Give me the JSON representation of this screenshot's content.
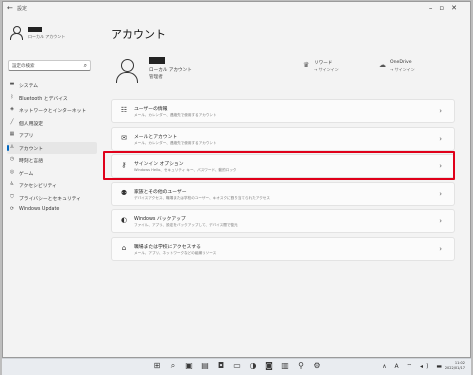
{
  "window": {
    "back_icon": "arrow-left-icon",
    "title": "設定",
    "controls": [
      "–",
      "▫",
      "✕"
    ]
  },
  "sidebar": {
    "profile_sub": "ローカル アカウント",
    "search_placeholder": "設定の検索",
    "items": [
      {
        "label": "システム",
        "icon": "monitor-icon",
        "glyph": "▬"
      },
      {
        "label": "Bluetooth とデバイス",
        "icon": "bluetooth-icon",
        "glyph": "ᛒ"
      },
      {
        "label": "ネットワークとインターネット",
        "icon": "network-icon",
        "glyph": "◈"
      },
      {
        "label": "個人用設定",
        "icon": "pen-icon",
        "glyph": "╱"
      },
      {
        "label": "アプリ",
        "icon": "apps-icon",
        "glyph": "▦"
      },
      {
        "label": "アカウント",
        "icon": "person-icon",
        "glyph": "♙",
        "active": true
      },
      {
        "label": "時刻と言語",
        "icon": "clock-globe-icon",
        "glyph": "◷"
      },
      {
        "label": "ゲーム",
        "icon": "game-icon",
        "glyph": "◎"
      },
      {
        "label": "アクセシビリティ",
        "icon": "accessibility-icon",
        "glyph": "♿"
      },
      {
        "label": "プライバシーとセキュリティ",
        "icon": "shield-icon",
        "glyph": "⛉"
      },
      {
        "label": "Windows Update",
        "icon": "update-icon",
        "glyph": "⟳"
      }
    ]
  },
  "main": {
    "title": "アカウント",
    "hero": {
      "account_type": "ローカル アカウント",
      "role": "管理者"
    },
    "services": [
      {
        "name": "リワード",
        "status": "→ サインイン",
        "icon": "trophy-icon",
        "glyph": "🏆"
      },
      {
        "name": "OneDrive",
        "status": "→ サインイン",
        "icon": "cloud-icon",
        "glyph": "☁"
      }
    ],
    "cards": [
      {
        "title": "ユーザーの情報",
        "desc": "メール、カレンダー、連絡先で使用するアカウント",
        "icon": "user-info-icon",
        "glyph": "☷"
      },
      {
        "title": "メールとアカウント",
        "desc": "メール、カレンダー、連絡先で使用するアカウント",
        "icon": "mail-icon",
        "glyph": "✉"
      },
      {
        "title": "サインイン オプション",
        "desc": "Windows Hello、セキュリティ キー、パスワード、動的ロック",
        "icon": "key-icon",
        "glyph": "⚷"
      },
      {
        "title": "家族とその他のユーザー",
        "desc": "デバイスアクセス、職場または学校のユーザー、キオスクに割り当てられたアクセス",
        "icon": "family-icon",
        "glyph": "⚉"
      },
      {
        "title": "Windows バックアップ",
        "desc": "ファイル、アプリ、設定をバックアップして、デバイス間で復元",
        "icon": "backup-icon",
        "glyph": "◐"
      },
      {
        "title": "職場または学校にアクセスする",
        "desc": "メール、アプリ、ネットワークなどの組織リソース",
        "icon": "briefcase-icon",
        "glyph": "⌂"
      }
    ],
    "chevron": "›"
  },
  "taskbar": {
    "icons": [
      {
        "name": "start-icon",
        "glyph": "⊞"
      },
      {
        "name": "search-icon",
        "glyph": "⌕"
      },
      {
        "name": "task-view-icon",
        "glyph": "▣"
      },
      {
        "name": "widgets-icon",
        "glyph": "▤"
      },
      {
        "name": "chat-icon",
        "glyph": "◘"
      },
      {
        "name": "file-explorer-icon",
        "glyph": "▭"
      },
      {
        "name": "edge-icon",
        "glyph": "◑"
      },
      {
        "name": "store-icon",
        "glyph": "◙"
      },
      {
        "name": "apps-icon",
        "glyph": "▥"
      },
      {
        "name": "map-pin-icon",
        "glyph": "⚲"
      },
      {
        "name": "settings-icon",
        "glyph": "⚙"
      }
    ],
    "tray": "∧ A ⌔ ◂) ▬",
    "time": "11:02",
    "date": "2022/01/17"
  },
  "colors": {
    "accent": "#0067c0",
    "highlight": "#e0001a"
  }
}
